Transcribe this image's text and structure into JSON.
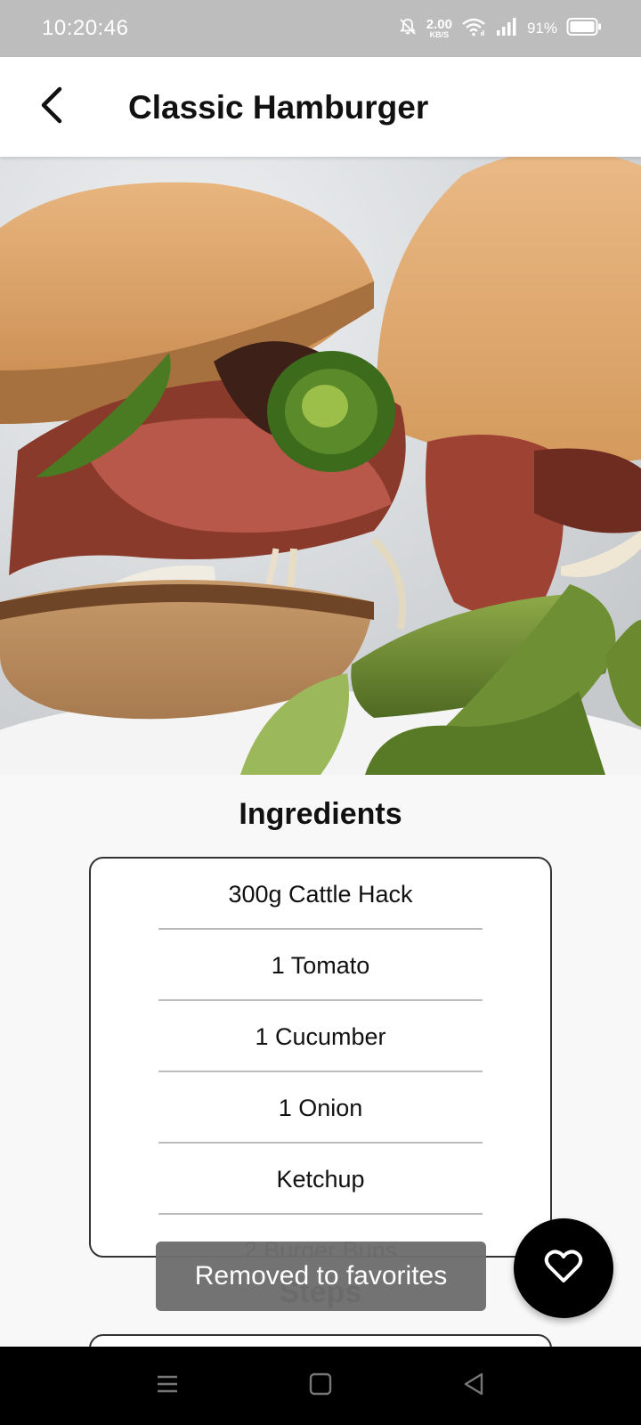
{
  "status_bar": {
    "time": "10:20:46",
    "net_speed_value": "2.00",
    "net_speed_unit": "KB/S",
    "battery": "91%"
  },
  "app_bar": {
    "title": "Classic Hamburger",
    "back_icon": "chevron-left-icon"
  },
  "hero": {
    "image": "hamburger-photo"
  },
  "ingredients": {
    "title": "Ingredients",
    "items": [
      "300g Cattle Hack",
      "1 Tomato",
      "1 Cucumber",
      "1 Onion",
      "Ketchup",
      "2 Burger Buns"
    ]
  },
  "steps": {
    "title": "Steps"
  },
  "toast": {
    "message": "Removed to favorites"
  },
  "fab": {
    "icon": "heart-outline-icon"
  },
  "nav_bar": {
    "icons": [
      "menu-icon",
      "home-square-icon",
      "back-triangle-icon"
    ]
  },
  "colors": {
    "status_bar_bg": "#bdbdbd",
    "app_bar_bg": "#ffffff",
    "page_bg": "#f8f8f8",
    "fab_bg": "#000000",
    "toast_bg": "#6e6e6e"
  }
}
